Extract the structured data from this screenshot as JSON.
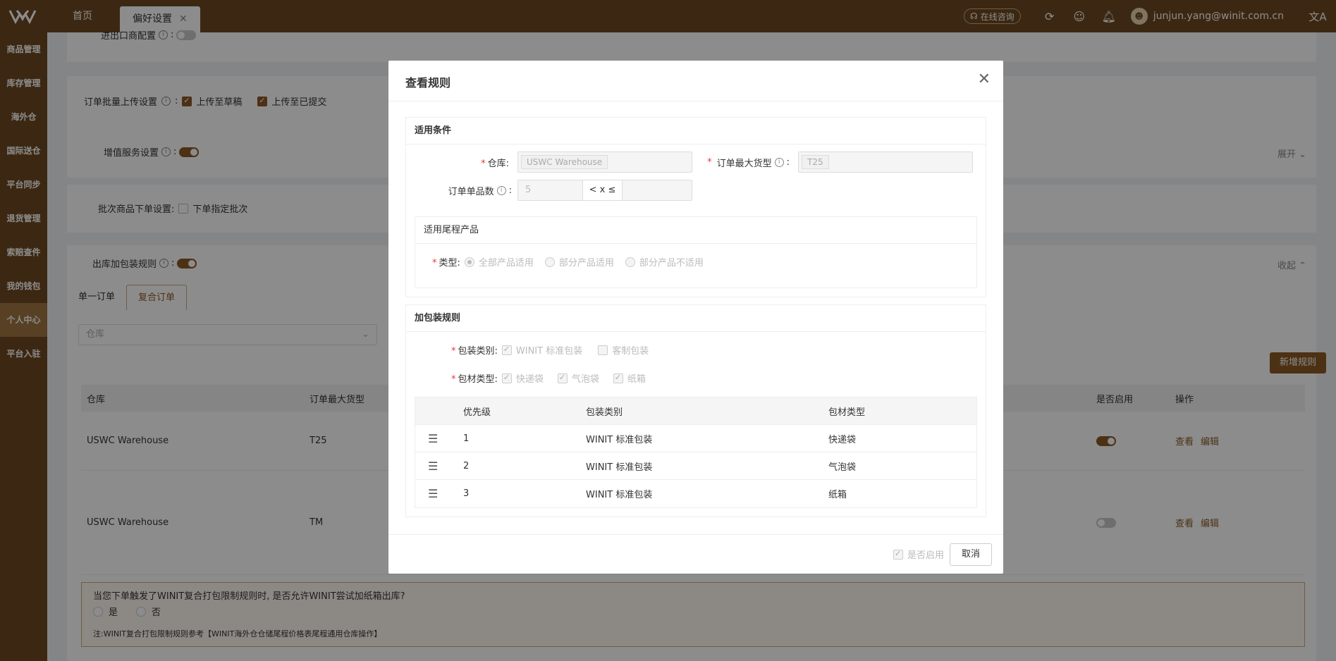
{
  "header": {
    "tabs": [
      "首页",
      "偏好设置"
    ],
    "consult_label": "在线咨询",
    "user_email": "junjun.yang@winit.com.cn"
  },
  "sidebar": {
    "items": [
      "商品管理",
      "库存管理",
      "海外仓",
      "国际送仓",
      "平台同步",
      "退货管理",
      "索赔查件",
      "我的钱包",
      "个人中心",
      "平台入驻"
    ],
    "active_index": 8
  },
  "page": {
    "import_export_label": "进出口商配置",
    "batch_upload_label": "订单批量上传设置",
    "upload_draft": "上传至草稿",
    "upload_submitted": "上传至已提交",
    "value_added_label": "增值服务设置",
    "expand_label": "展开",
    "batch_goods_label": "批次商品下单设置:",
    "specify_batch": "下单指定批次",
    "outbound_rule_label": "出库加包装规则",
    "collapse_label": "收起",
    "subtabs": [
      "单一订单",
      "复合订单"
    ],
    "warehouse_placeholder": "仓库",
    "new_rule_button": "新增规则",
    "table_headers": {
      "warehouse": "仓库",
      "max_size": "订单最大货型",
      "enabled": "是否启用",
      "actions": "操作"
    },
    "rows": [
      {
        "warehouse": "USWC Warehouse",
        "max_size": "T25",
        "enabled": true
      },
      {
        "warehouse": "USWC Warehouse",
        "max_size": "TM",
        "enabled": false
      }
    ],
    "view_label": "查看",
    "edit_label": "编辑",
    "notice_question": "当您下单触发了WINIT复合打包限制规则时, 是否允许WINIT尝试加纸箱出库?",
    "yes": "是",
    "no": "否",
    "notice_note": "注:WINIT复合打包限制规则参考【WINIT海外仓仓储尾程价格表尾程通用仓库操作】"
  },
  "modal": {
    "title": "查看规则",
    "conditions_title": "适用条件",
    "warehouse_label": "仓库:",
    "warehouse_value": "USWC Warehouse",
    "max_size_label": "订单最大货型",
    "max_size_value": "T25",
    "item_count_label": "订单单品数",
    "item_count_min": "5",
    "item_count_op": "< x ≤",
    "last_mile_title": "适用尾程产品",
    "type_label": "类型:",
    "type_options": [
      "全部产品适用",
      "部分产品适用",
      "部分产品不适用"
    ],
    "packaging_title": "加包装规则",
    "pack_category_label": "包装类别:",
    "pack_categories": [
      "WINIT 标准包装",
      "客制包装"
    ],
    "material_label": "包材类型:",
    "materials": [
      "快递袋",
      "气泡袋",
      "纸箱"
    ],
    "table_headers": {
      "priority": "优先级",
      "category": "包装类别",
      "material": "包材类型"
    },
    "rows": [
      {
        "priority": "1",
        "category": "WINIT 标准包装",
        "material": "快递袋"
      },
      {
        "priority": "2",
        "category": "WINIT 标准包装",
        "material": "气泡袋"
      },
      {
        "priority": "3",
        "category": "WINIT 标准包装",
        "material": "纸箱"
      }
    ],
    "enabled_label": "是否启用",
    "cancel_button": "取消"
  },
  "colors": {
    "brand": "#6e4a21",
    "accent": "#8a5a26"
  }
}
